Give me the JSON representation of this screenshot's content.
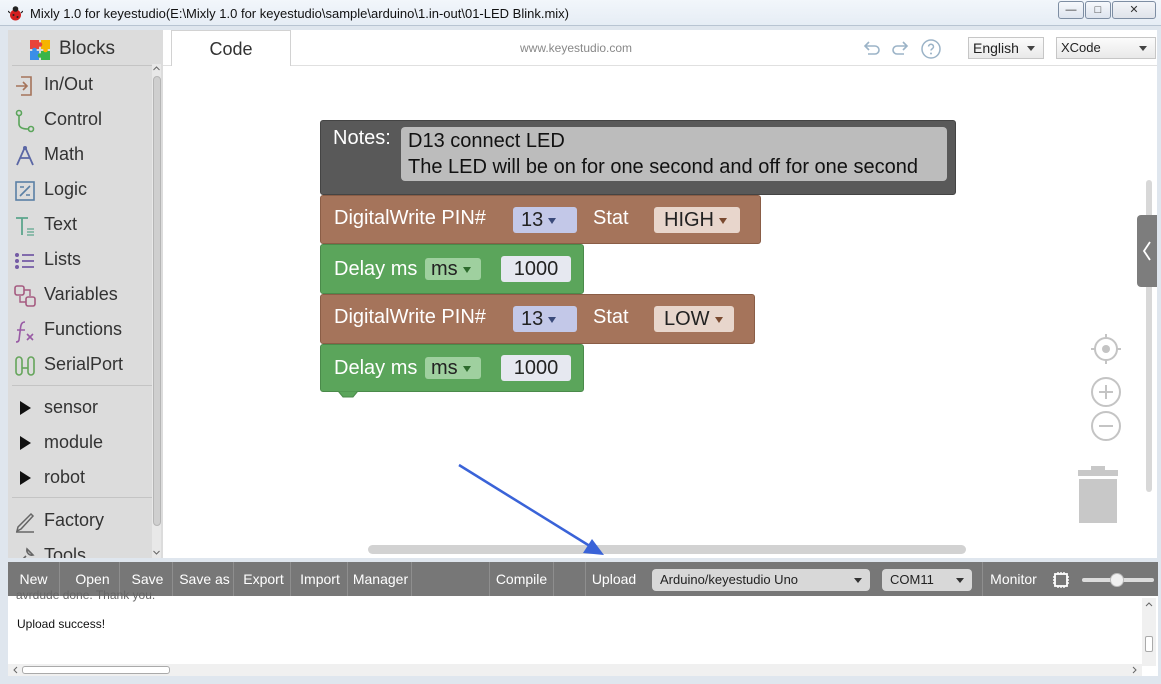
{
  "window": {
    "title": "Mixly 1.0 for keyestudio(E:\\Mixly 1.0 for keyestudio\\sample\\arduino\\1.in-out\\01-LED Blink.mix)",
    "minimize": "—",
    "maximize": "□",
    "close": "✕"
  },
  "toolbox": {
    "header": "Blocks",
    "categories": [
      {
        "label": "In/Out",
        "icon": "in-out-icon",
        "color": "#a5745b"
      },
      {
        "label": "Control",
        "icon": "control-icon",
        "color": "#5ba55b"
      },
      {
        "label": "Math",
        "icon": "math-icon",
        "color": "#5b67a5"
      },
      {
        "label": "Logic",
        "icon": "logic-icon",
        "color": "#5b80a5"
      },
      {
        "label": "Text",
        "icon": "text-icon",
        "color": "#5ba58c"
      },
      {
        "label": "Lists",
        "icon": "lists-icon",
        "color": "#745ba5"
      },
      {
        "label": "Variables",
        "icon": "variables-icon",
        "color": "#a55b80"
      },
      {
        "label": "Functions",
        "icon": "functions-icon",
        "color": "#995ba5"
      },
      {
        "label": "SerialPort",
        "icon": "serialport-icon",
        "color": "#65a55b"
      }
    ],
    "groups": [
      "sensor",
      "module",
      "robot"
    ],
    "extra": [
      {
        "label": "Factory",
        "icon": "factory-icon"
      },
      {
        "label": "Tools",
        "icon": "tools-icon"
      }
    ]
  },
  "tabs": {
    "code": "Code",
    "site": "www.keyestudio.com"
  },
  "language_select": "English",
  "theme_select": "XCode",
  "blocks": {
    "notes_label": "Notes:",
    "notes_line1": "D13 connect LED",
    "notes_line2": "The LED will be on for one second and off for one second",
    "write1": {
      "label": "DigitalWrite PIN#",
      "pin": "13",
      "stat_label": "Stat",
      "stat": "HIGH"
    },
    "delay1": {
      "label": "Delay ms",
      "unit": "ms",
      "value": "1000"
    },
    "write2": {
      "label": "DigitalWrite PIN#",
      "pin": "13",
      "stat_label": "Stat",
      "stat": "LOW"
    },
    "delay2": {
      "label": "Delay ms",
      "unit": "ms",
      "value": "1000"
    }
  },
  "bottom_toolbar": {
    "new": "New",
    "open": "Open",
    "save": "Save",
    "save_as": "Save as",
    "export": "Export",
    "import": "Import",
    "manager": "Manager",
    "compile": "Compile",
    "upload": "Upload",
    "board": "Arduino/keyestudio Uno",
    "port": "COM11",
    "monitor": "Monitor"
  },
  "console": {
    "previous_line": "avrdude done.  Thank you.",
    "message": "Upload success!"
  },
  "colors": {
    "inout_block": "#a5745b",
    "delay_block": "#5ba55b",
    "notes_block": "#595959",
    "toolbar": "#777777",
    "annotation_arrow": "#3a63d8"
  }
}
